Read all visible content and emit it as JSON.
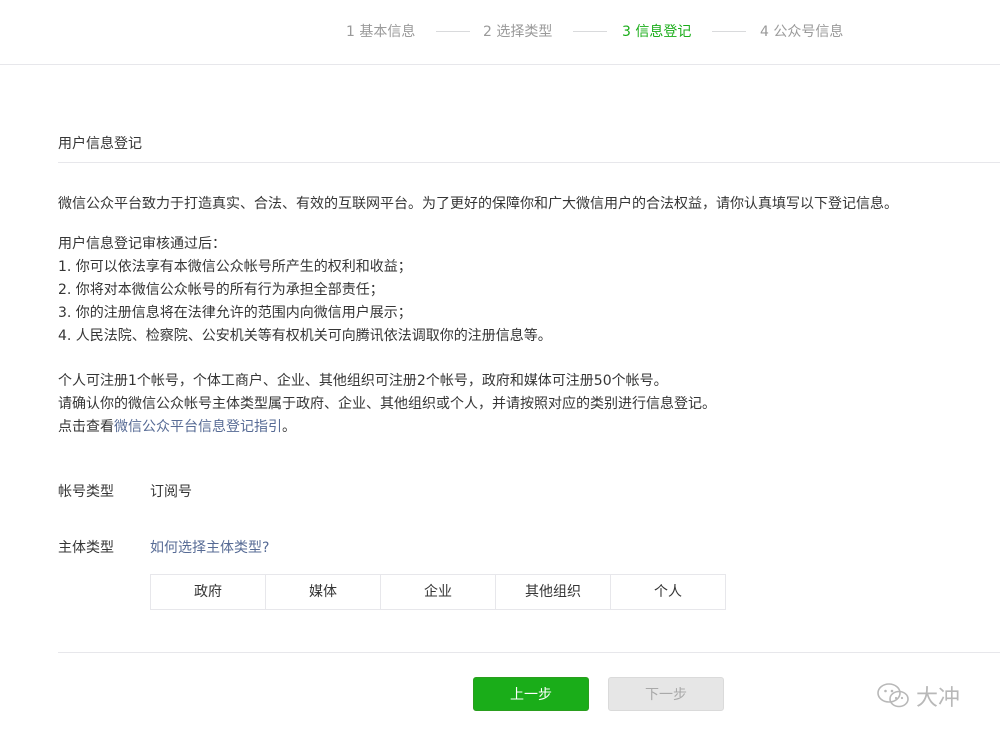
{
  "steps": [
    {
      "label": "1 基本信息"
    },
    {
      "label": "2 选择类型"
    },
    {
      "label": "3 信息登记"
    },
    {
      "label": "4 公众号信息"
    }
  ],
  "active_step": 3,
  "section": {
    "title": "用户信息登记"
  },
  "intro": "微信公众平台致力于打造真实、合法、有效的互联网平台。为了更好的保障你和广大微信用户的合法权益，请你认真填写以下登记信息。",
  "review": {
    "heading": "用户信息登记审核通过后：",
    "items": [
      "1. 你可以依法享有本微信公众帐号所产生的权利和收益；",
      "2. 你将对本微信公众帐号的所有行为承担全部责任；",
      "3. 你的注册信息将在法律允许的范围内向微信用户展示；",
      "4. 人民法院、检察院、公安机关等有权机关可向腾讯依法调取你的注册信息等。"
    ]
  },
  "notes": {
    "line1": "个人可注册1个帐号，个体工商户、企业、其他组织可注册2个帐号，政府和媒体可注册50个帐号。",
    "line2": "请确认你的微信公众帐号主体类型属于政府、企业、其他组织或个人，并请按照对应的类别进行信息登记。",
    "line3_prefix": "点击查看",
    "line3_link": "微信公众平台信息登记指引",
    "line3_suffix": "。"
  },
  "form": {
    "account_type_label": "帐号类型",
    "account_type_value": "订阅号",
    "entity_type_label": "主体类型",
    "entity_type_help": "如何选择主体类型?",
    "entity_options": [
      "政府",
      "媒体",
      "企业",
      "其他组织",
      "个人"
    ]
  },
  "buttons": {
    "prev": "上一步",
    "next": "下一步"
  },
  "watermark": {
    "text": "大冲"
  },
  "colors": {
    "accent": "#1aad19",
    "link": "#576b95",
    "text": "#353535",
    "muted": "#9a9a9a"
  }
}
